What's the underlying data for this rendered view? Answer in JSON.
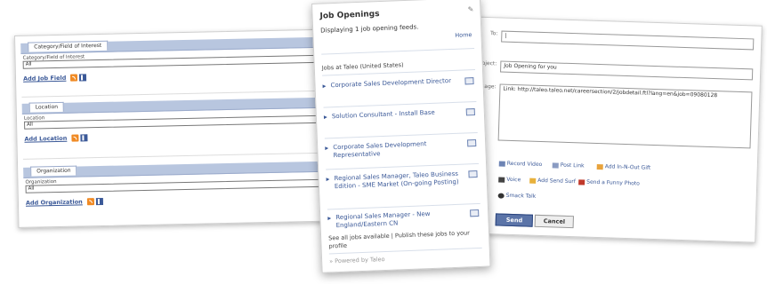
{
  "left_card": {
    "sections": [
      {
        "header": "Category/Field of Interest",
        "field_label": "Category/Field of Interest",
        "value": "All",
        "add_label": "Add Job Field"
      },
      {
        "header": "Location",
        "field_label": "Location",
        "value": "All",
        "add_label": "Add Location"
      },
      {
        "header": "Organization",
        "field_label": "Organization",
        "value": "All",
        "add_label": "Add Organization"
      }
    ],
    "icons": [
      "rss-icon",
      "facebook-icon"
    ]
  },
  "center_card": {
    "title": "Job Openings",
    "subtitle": "Displaying 1 job opening feeds.",
    "home_link": "Home",
    "source": "Jobs at Taleo (United States)",
    "jobs": [
      "Corporate Sales Development Director",
      "Solution Consultant - Install Base",
      "Corporate Sales Development Representative",
      "Regional Sales Manager, Taleo Business Edition - SME Market (On-going Posting)",
      "Regional Sales Manager - New England/Eastern CN"
    ],
    "footer": "See all jobs available | Publish these jobs to your profile",
    "powered_by": "Powered by Taleo"
  },
  "right_card": {
    "to_label": "To:",
    "to_value": "|",
    "subject_label": "Subject:",
    "subject_value": "Job Opening for you",
    "message_label": "Message:",
    "message_value": "Link: http://taleo.taleo.net/careersection/2/jobdetail.ftl?lang=en&job=09080128",
    "attachments": [
      "Record Video",
      "Post Link",
      "Add In-N-Out Gift",
      "Voice",
      "Add Send Surf",
      "Send a Funny Photo",
      "Smack Talk"
    ],
    "send_label": "Send",
    "cancel_label": "Cancel"
  }
}
